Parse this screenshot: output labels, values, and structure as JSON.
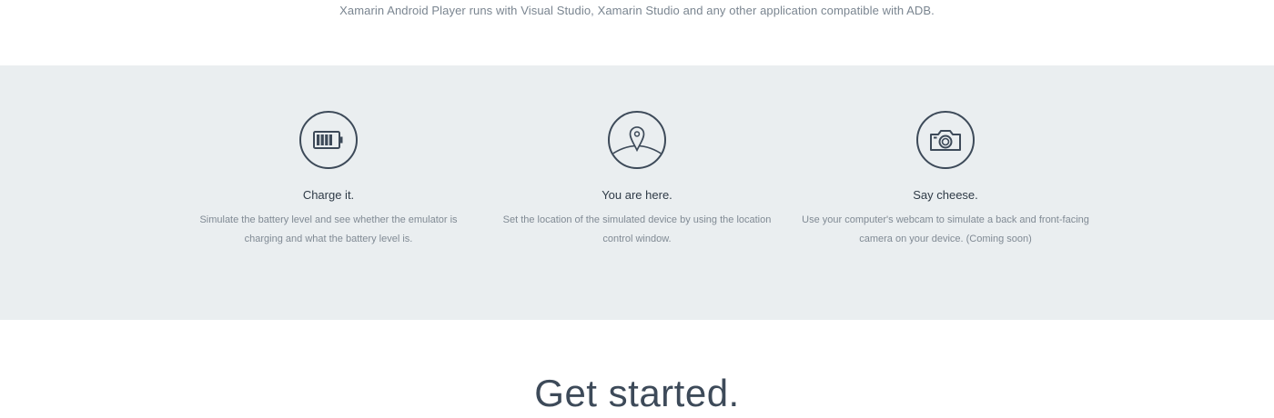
{
  "intro": {
    "text": "Xamarin Android Player runs with Visual Studio, Xamarin Studio and any other application compatible with ADB."
  },
  "features": [
    {
      "icon": "battery-icon",
      "title": "Charge it.",
      "description": "Simulate the battery level and see whether the emulator is charging and what the battery level is."
    },
    {
      "icon": "location-pin-icon",
      "title": "You are here.",
      "description": "Set the location of the simulated device by using the location control window."
    },
    {
      "icon": "camera-icon",
      "title": "Say cheese.",
      "description": "Use your computer's webcam to simulate a back and front-facing camera on your device. (Coming soon)"
    }
  ],
  "cta": {
    "heading": "Get started."
  },
  "colors": {
    "section_bg": "#eaeef0",
    "icon_stroke": "#3d4a59",
    "body_text": "#808a94"
  }
}
